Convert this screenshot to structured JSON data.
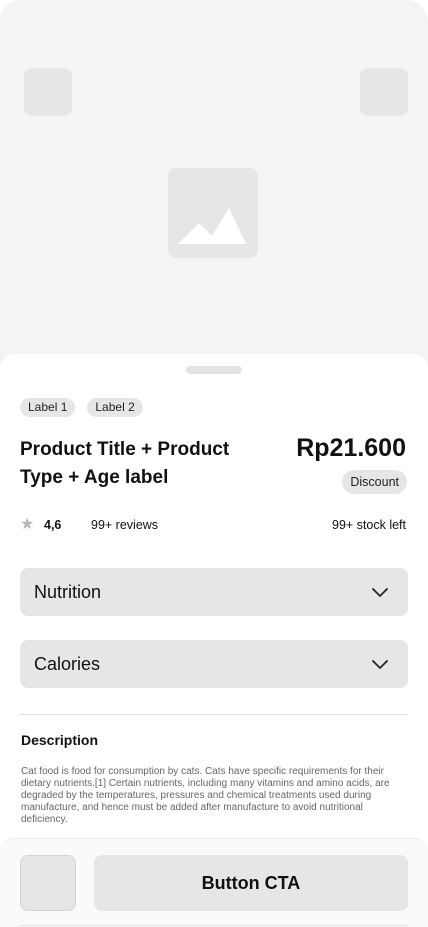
{
  "colors": {
    "hero_bg": "#f4f4f4",
    "placeholder": "#e6e6e6",
    "text": "#111111",
    "muted_text": "#666666"
  },
  "hero": {
    "left_button_icon": "placeholder-icon",
    "right_button_icon": "placeholder-icon",
    "image_icon": "image-placeholder-icon"
  },
  "product": {
    "labels": [
      "Label 1",
      "Label 2"
    ],
    "title": "Product Title + Product Type + Age label",
    "price": "Rp21.600",
    "discount": "Discount",
    "rating": "4,6",
    "reviews": "99+ reviews",
    "stock": "99+ stock left"
  },
  "accordions": [
    {
      "label": "Nutrition"
    },
    {
      "label": "Calories"
    }
  ],
  "description": {
    "title": "Description",
    "text": "Cat food is food for consumption by cats. Cats have specific requirements for their dietary nutrients.[1] Certain nutrients, including many vitamins and amino acids, are degraded by the temperatures, pressures and chemical treatments used during manufacture, and hence must be added after manufacture to avoid nutritional deficiency."
  },
  "footer": {
    "cta_label": "Button CTA"
  }
}
